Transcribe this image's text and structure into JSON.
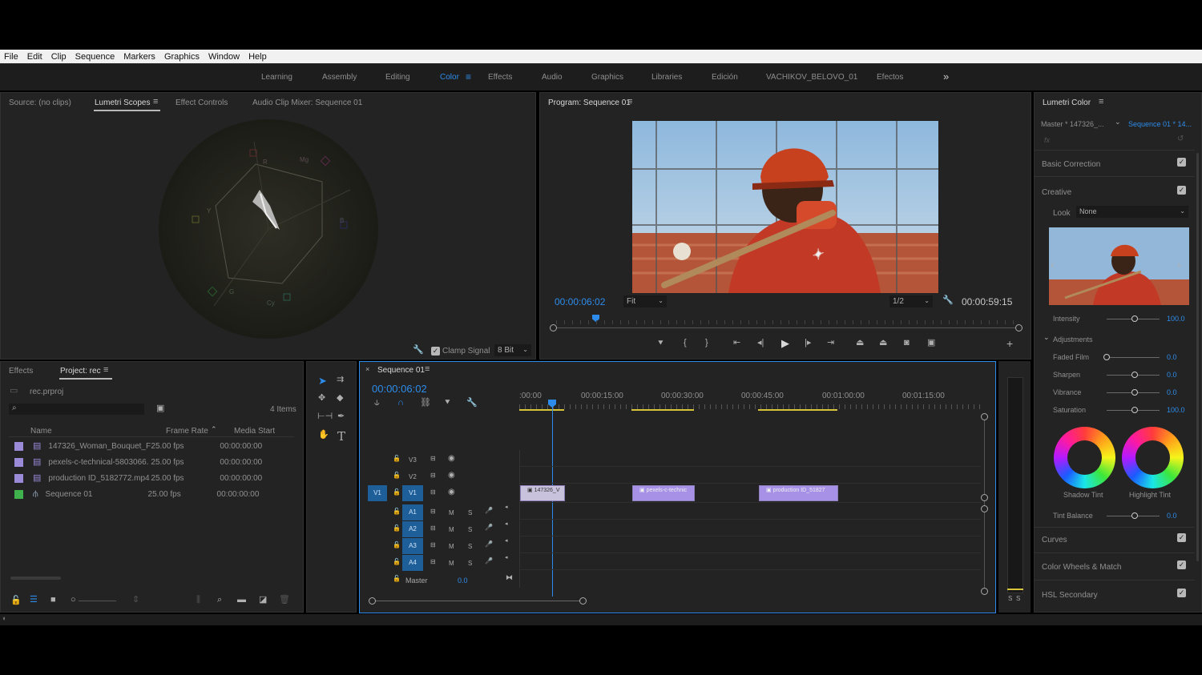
{
  "menu": [
    "File",
    "Edit",
    "Clip",
    "Sequence",
    "Markers",
    "Graphics",
    "Window",
    "Help"
  ],
  "workspaces": [
    "Learning",
    "Assembly",
    "Editing",
    "Color",
    "Effects",
    "Audio",
    "Graphics",
    "Libraries",
    "Edición",
    "VACHIKOV_BELOVO_01",
    "Efectos"
  ],
  "source_panel": {
    "tabs": [
      "Source: (no clips)",
      "Lumetri Scopes",
      "Effect Controls",
      "Audio Clip Mixer: Sequence 01"
    ],
    "clamp_label": "Clamp Signal",
    "bit_depth": "8 Bit",
    "vectorscope_labels": [
      "R",
      "Mg",
      "B",
      "Cy",
      "G",
      "Y"
    ]
  },
  "program": {
    "title": "Program: Sequence 01",
    "timecode": "00:00:06:02",
    "fit": "Fit",
    "resolution": "1/2",
    "duration": "00:00:59:15"
  },
  "project": {
    "tab_effects": "Effects",
    "tab_project": "Project: rec",
    "file": "rec.prproj",
    "search_placeholder": "",
    "item_count": "4 Items",
    "columns": [
      "Name",
      "Frame Rate",
      "Media Start"
    ],
    "rows": [
      {
        "color": "#9a8ad8",
        "name": "147326_Woman_Bouquet_Fi",
        "fps": "25.00 fps",
        "start": "00:00:00:00"
      },
      {
        "color": "#9a8ad8",
        "name": "pexels-c-technical-5803066.",
        "fps": "25.00 fps",
        "start": "00:00:00:00"
      },
      {
        "color": "#9a8ad8",
        "name": "production ID_5182772.mp4",
        "fps": "25.00 fps",
        "start": "00:00:00:00"
      },
      {
        "color": "#3fb24d",
        "name": "Sequence 01",
        "fps": "25.00 fps",
        "start": "00:00:00:00"
      }
    ]
  },
  "timeline": {
    "title": "Sequence 01",
    "timecode": "00:00:06:02",
    "ruler": [
      ":00:00",
      "00:00:15:00",
      "00:00:30:00",
      "00:00:45:00",
      "00:01:00:00",
      "00:01:15:00"
    ],
    "video_tracks": [
      "V3",
      "V2",
      "V1"
    ],
    "audio_tracks": [
      "A1",
      "A2",
      "A3",
      "A4"
    ],
    "source_patch_v": "V1",
    "master_label": "Master",
    "master_value": "0.0",
    "clips": [
      "147326_V",
      "pexels-c-technic",
      "production ID_51827"
    ]
  },
  "meter": {
    "labels": [
      "S",
      "S"
    ]
  },
  "lumetri": {
    "title": "Lumetri Color",
    "master": "Master * 147326_...",
    "sequence": "Sequence 01 * 14...",
    "fx": "fx",
    "basic_correction": "Basic Correction",
    "creative": "Creative",
    "look_label": "Look",
    "look_value": "None",
    "intensity_label": "Intensity",
    "intensity_value": "100.0",
    "adjustments": "Adjustments",
    "faded_film": "Faded Film",
    "faded_film_value": "0.0",
    "sharpen": "Sharpen",
    "sharpen_value": "0.0",
    "vibrance": "Vibrance",
    "vibrance_value": "0.0",
    "saturation": "Saturation",
    "saturation_value": "100.0",
    "shadow_tint": "Shadow Tint",
    "highlight_tint": "Highlight Tint",
    "tint_balance": "Tint Balance",
    "tint_balance_value": "0.0",
    "curves": "Curves",
    "color_wheels": "Color Wheels & Match",
    "hsl": "HSL Secondary"
  },
  "colors": {
    "accent": "#2d8ceb",
    "video_clip": "#a691e6",
    "audio_track": "#1e5f9a",
    "work_area": "#d8c43a"
  }
}
